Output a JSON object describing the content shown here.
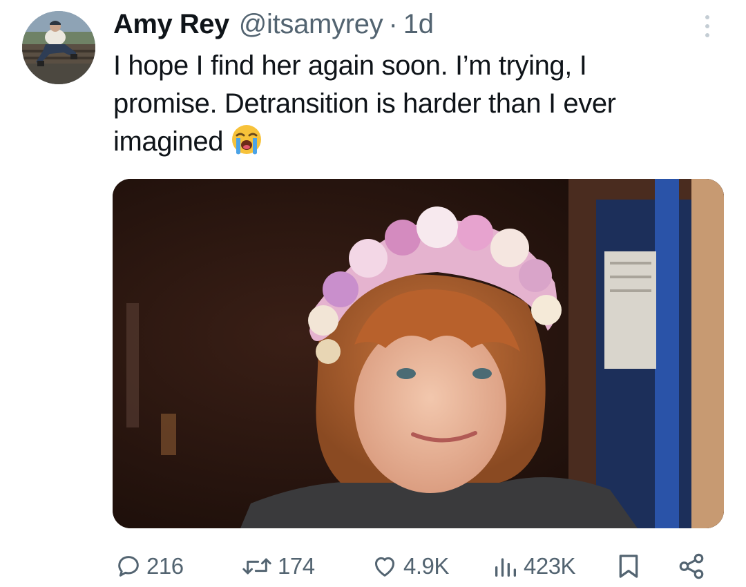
{
  "tweet": {
    "author_name": "Amy Rey",
    "author_handle": "@itsamyrey",
    "separator": "·",
    "time": "1d",
    "text_lines": [
      "I hope I find her again soon. I’m trying, I",
      "promise. Detransition is harder than I ever",
      "imagined"
    ],
    "emoji": "loudly-crying-face"
  },
  "actions": {
    "replies": "216",
    "retweets": "174",
    "likes": "4.9K",
    "views": "423K"
  },
  "colors": {
    "text": "#0f1419",
    "secondary": "#536471",
    "more_dots": "#c4cdd4"
  }
}
